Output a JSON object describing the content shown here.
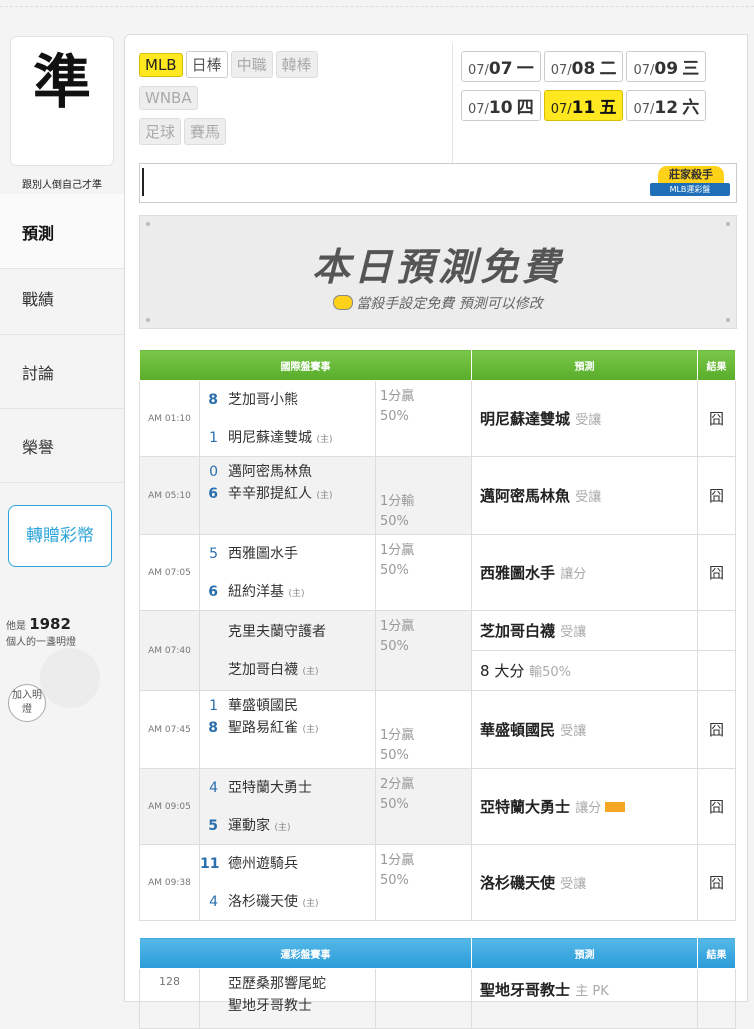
{
  "logo": {
    "char": "準",
    "subtitle": "跟別人倒自己才準"
  },
  "nav": [
    {
      "label": "預測",
      "active": true
    },
    {
      "label": "戰績",
      "active": false
    },
    {
      "label": "討論",
      "active": false
    },
    {
      "label": "榮譽",
      "active": false
    }
  ],
  "gift_button": "轉贈彩幣",
  "lamp": {
    "prefix": "他是",
    "count": "1982",
    "suffix": "個人的一盞明燈",
    "join": "加入明燈"
  },
  "league_tabs": [
    {
      "label": "MLB",
      "state": "selected"
    },
    {
      "label": "日棒",
      "state": "normal"
    },
    {
      "label": "中職",
      "state": "disabled"
    },
    {
      "label": "韓棒",
      "state": "disabled"
    },
    {
      "label": "WNBA",
      "state": "disabled"
    },
    {
      "label": "足球",
      "state": "disabled"
    },
    {
      "label": "賽馬",
      "state": "disabled"
    }
  ],
  "date_tabs": [
    {
      "md": "07/",
      "day": "07",
      "wd": "一",
      "selected": false
    },
    {
      "md": "07/",
      "day": "08",
      "wd": "二",
      "selected": false
    },
    {
      "md": "07/",
      "day": "09",
      "wd": "三",
      "selected": false
    },
    {
      "md": "07/",
      "day": "10",
      "wd": "四",
      "selected": false
    },
    {
      "md": "07/",
      "day": "11",
      "wd": "五",
      "selected": true
    },
    {
      "md": "07/",
      "day": "12",
      "wd": "六",
      "selected": false
    }
  ],
  "killer_badge": {
    "top": "莊家殺手",
    "bottom": "MLB運彩盤"
  },
  "banner": {
    "title": "本日預測免費",
    "subtitle": "當殺手設定免費  預測可以修改"
  },
  "table1": {
    "headers": [
      "國際盤賽事",
      "預測",
      "結果"
    ],
    "games": [
      {
        "time": "AM 01:10",
        "s1": "8",
        "t1": "芝加哥小熊",
        "s2": "1",
        "t2": "明尼蘇達雙城",
        "h2": "(主)",
        "odds1": "1分贏",
        "odds2": "50%",
        "pred": "明尼蘇達雙城",
        "hint": "受讓",
        "result": "囧",
        "layout": "split"
      },
      {
        "time": "AM 05:10",
        "s1": "0",
        "t1": "邁阿密馬林魚",
        "s2": "6",
        "t2": "辛辛那提紅人",
        "h2": "(主)",
        "odds1": "1分輸",
        "odds2": "50%",
        "pred": "邁阿密馬林魚",
        "hint": "受讓",
        "result": "囧",
        "layout": "top"
      },
      {
        "time": "AM 07:05",
        "s1": "5",
        "t1": "西雅圖水手",
        "s2": "6",
        "t2": "紐約洋基",
        "h2": "(主)",
        "odds1": "1分贏",
        "odds2": "50%",
        "pred": "西雅圖水手",
        "hint": "讓分",
        "result": "囧",
        "layout": "split"
      },
      {
        "time": "AM 07:40",
        "s1": "",
        "t1": "克里夫蘭守護者",
        "s2": "",
        "t2": "芝加哥白襪",
        "h2": "(主)",
        "odds1": "1分贏",
        "odds2": "50%",
        "pred": "芝加哥白襪",
        "hint": "受讓",
        "pred2": "8 大分",
        "hint2": "輸50%",
        "result": "",
        "layout": "double"
      },
      {
        "time": "AM 07:45",
        "s1": "1",
        "t1": "華盛頓國民",
        "s2": "8",
        "t2": "聖路易紅雀",
        "h2": "(主)",
        "odds1": "1分贏",
        "odds2": "50%",
        "pred": "華盛頓國民",
        "hint": "受讓",
        "result": "囧",
        "layout": "top"
      },
      {
        "time": "AM 09:05",
        "s1": "4",
        "t1": "亞特蘭大勇士",
        "s2": "5",
        "t2": "運動家",
        "h2": "(主)",
        "odds1": "2分贏",
        "odds2": "50%",
        "pred": "亞特蘭大勇士",
        "hint": "讓分",
        "tag": true,
        "result": "囧",
        "layout": "split"
      },
      {
        "time": "AM 09:38",
        "s1": "11",
        "t1": "德州遊騎兵",
        "s2": "4",
        "t2": "洛杉磯天使",
        "h2": "(主)",
        "odds1": "1分贏",
        "odds2": "50%",
        "pred": "洛杉磯天使",
        "hint": "受讓",
        "result": "囧",
        "layout": "split"
      }
    ]
  },
  "table2": {
    "headers": [
      "運彩盤賽事",
      "預測",
      "結果"
    ],
    "games": [
      {
        "time": "128",
        "t1": "亞歷桑那響尾蛇",
        "t2": "聖地牙哥教士",
        "pred": "聖地牙哥教士",
        "hint": "主 PK"
      }
    ]
  }
}
